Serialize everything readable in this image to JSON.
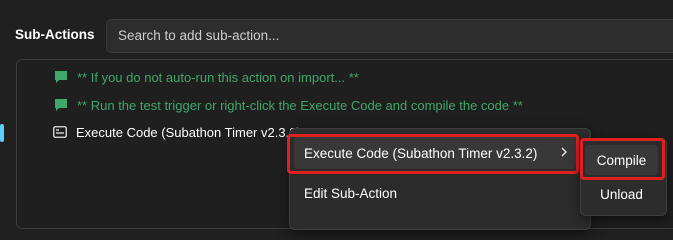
{
  "sub_actions": {
    "title": "Sub-Actions",
    "search_placeholder": "Search to add sub-action..."
  },
  "list": {
    "comments": [
      "** If you do not auto-run this action on import... **",
      "** Run the test trigger or right-click the Execute Code and compile the code **"
    ],
    "code_item": "Execute Code (Subathon Timer v2.3.2)"
  },
  "context_menu": {
    "items": [
      "Execute Code (Subathon Timer v2.3.2)",
      "Edit Sub-Action"
    ]
  },
  "submenu": {
    "items": [
      "Compile",
      "Unload"
    ]
  },
  "colors": {
    "comment": "#3fa66c",
    "highlight": "#e02020",
    "selection": "#60cdff"
  },
  "icons": {
    "comment": "comment-icon",
    "code": "code-icon",
    "chevron": "chevron-right-icon"
  }
}
